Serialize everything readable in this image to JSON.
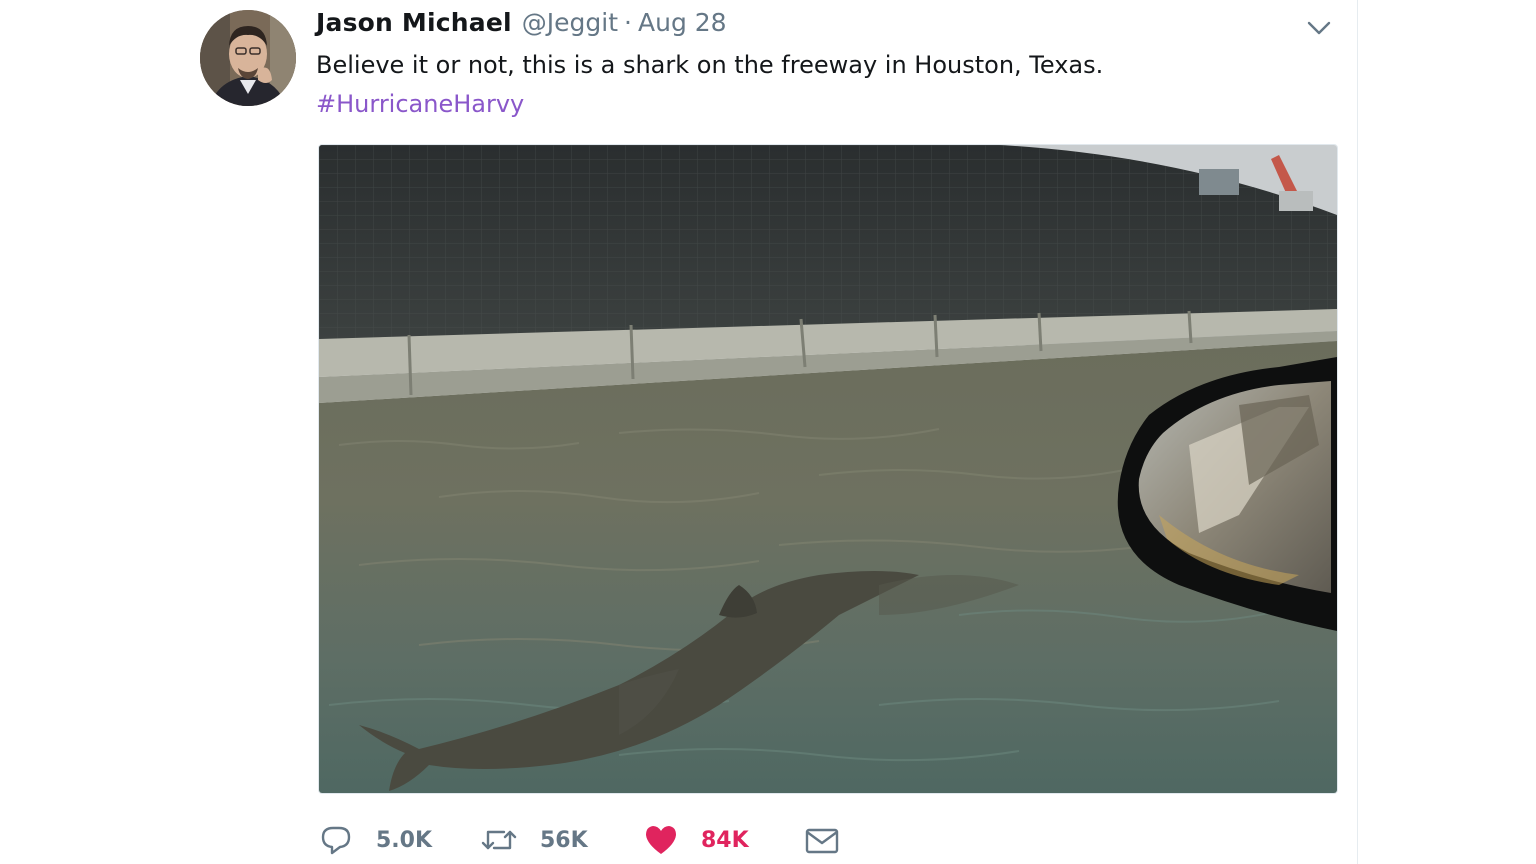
{
  "tweet": {
    "author_name": "Jason Michael",
    "handle": "@Jeggit",
    "separator": "·",
    "date": "Aug 28",
    "text": "Believe it or not, this is a shark on the freeway in Houston, Texas.",
    "hashtag": "#HurricaneHarvy"
  },
  "actions": {
    "reply_count": "5.0K",
    "retweet_count": "56K",
    "like_count": "84K"
  },
  "icons": {
    "reply": "reply-icon",
    "retweet": "retweet-icon",
    "like": "heart-icon",
    "message": "envelope-icon",
    "menu": "chevron-down-icon"
  },
  "colors": {
    "hashtag": "#8a57ca",
    "like": "#e0245e",
    "muted": "#657786",
    "text": "#14171a"
  }
}
